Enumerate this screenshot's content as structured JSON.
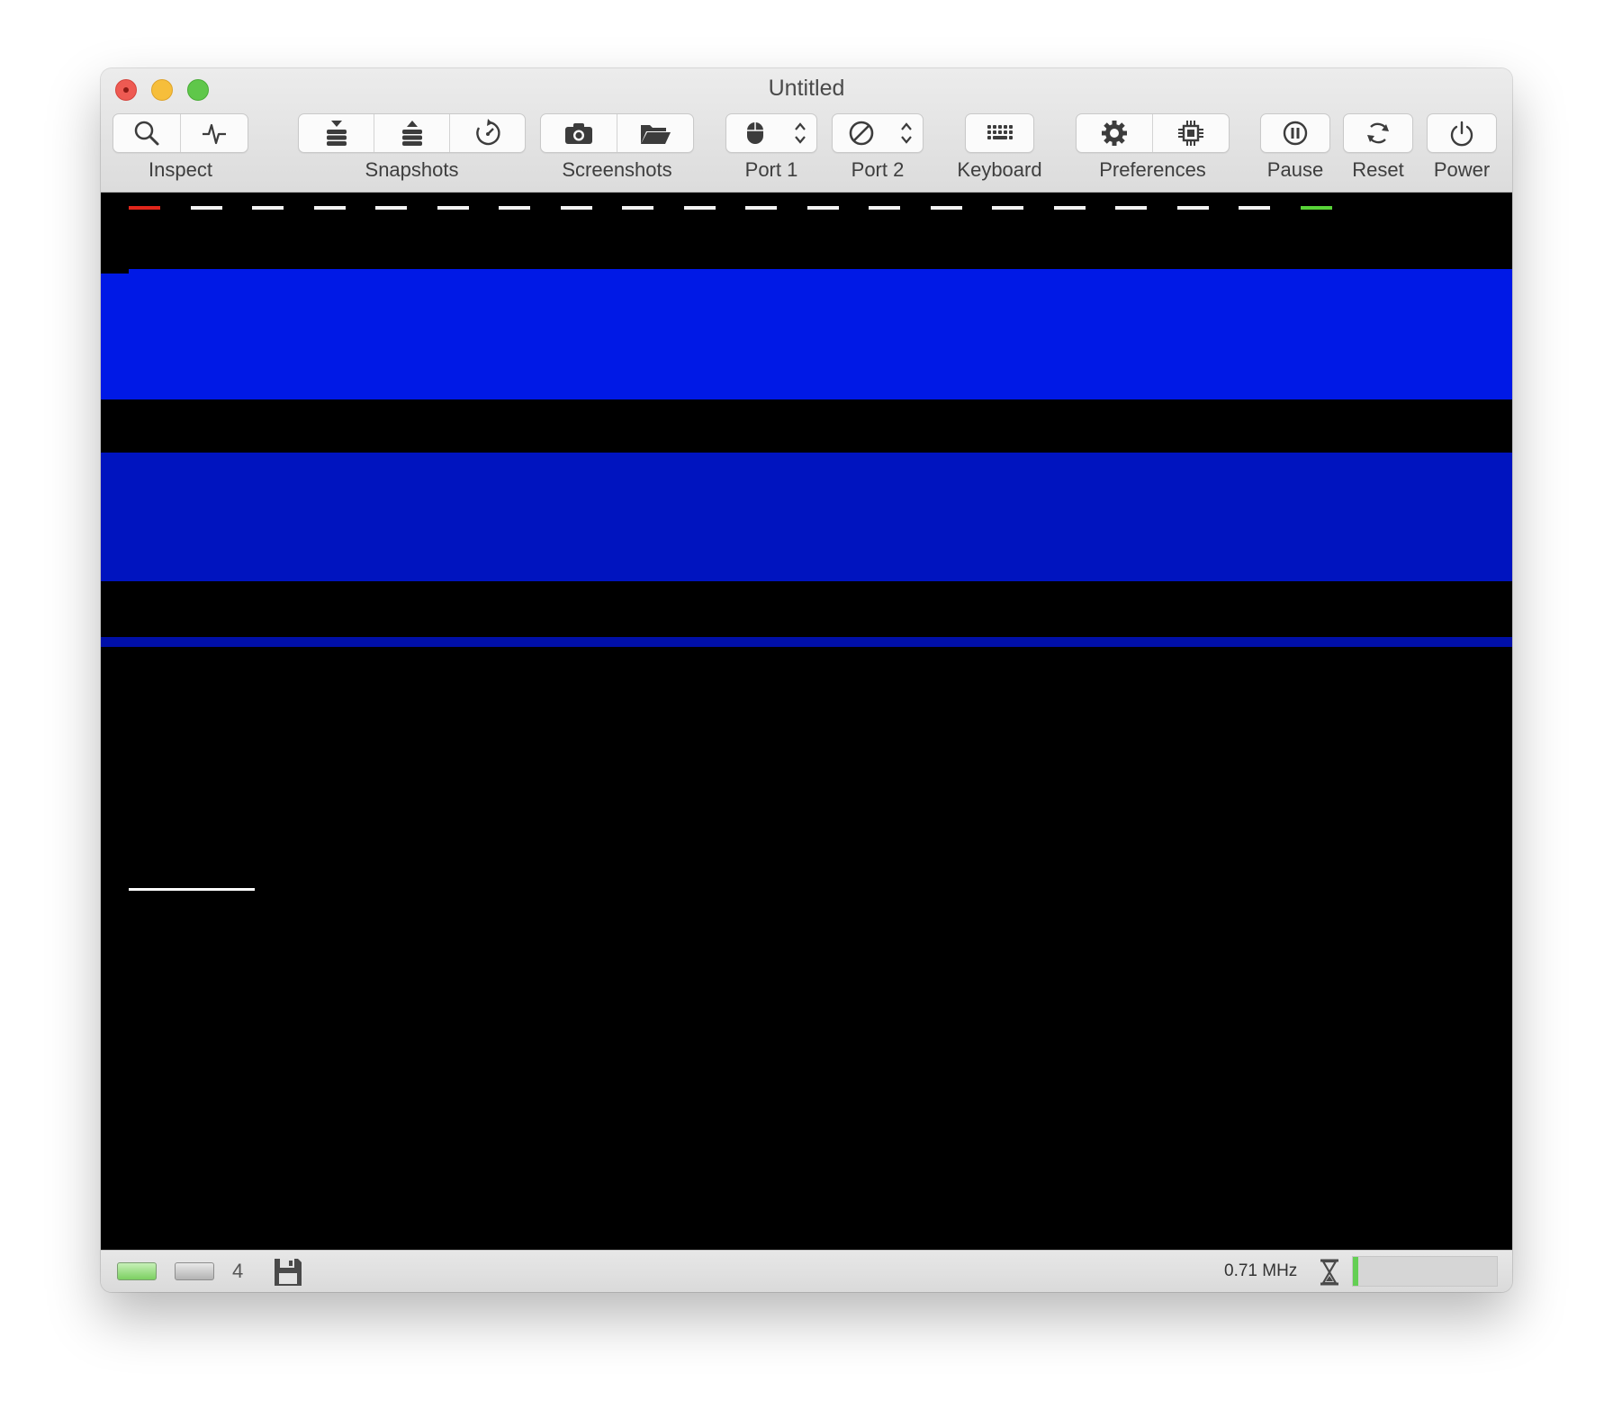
{
  "window": {
    "title": "Untitled"
  },
  "toolbar": {
    "groups": [
      {
        "label": "Inspect",
        "icons": [
          "inspect-search-icon",
          "activity-monitor-icon"
        ]
      },
      {
        "label": "Snapshots",
        "icons": [
          "take-snapshot-icon",
          "restore-snapshot-icon",
          "snapshot-browser-icon"
        ]
      },
      {
        "label": "Screenshots",
        "icons": [
          "camera-icon",
          "folder-icon"
        ]
      },
      {
        "label": "Port 1",
        "icons": [
          "mouse-icon",
          "stepper-icon"
        ]
      },
      {
        "label": "Port 2",
        "icons": [
          "none-icon",
          "stepper-icon"
        ]
      },
      {
        "label": "Keyboard",
        "icons": [
          "keyboard-icon"
        ]
      },
      {
        "label": "Preferences",
        "icons": [
          "gear-icon",
          "chip-icon"
        ]
      },
      {
        "label": "Pause",
        "icons": [
          "pause-icon"
        ]
      },
      {
        "label": "Reset",
        "icons": [
          "reset-icon"
        ]
      },
      {
        "label": "Power",
        "icons": [
          "power-icon"
        ]
      }
    ]
  },
  "emulator_screen": {
    "background": "#000000",
    "band_colors": [
      "#0019e6",
      "#0014bf",
      "#000fa8"
    ],
    "dash_color": "#f2f2f2",
    "first_dash_color": "#e0261b",
    "last_dash_color": "#58d338",
    "cursor_color": "#ffffff"
  },
  "statusbar": {
    "drive_count": "4",
    "clock_speed": "0.71 MHz",
    "speed_meter_fraction": 0.04,
    "led_on_color": "#7cd061",
    "meter_color": "#64cf54"
  }
}
